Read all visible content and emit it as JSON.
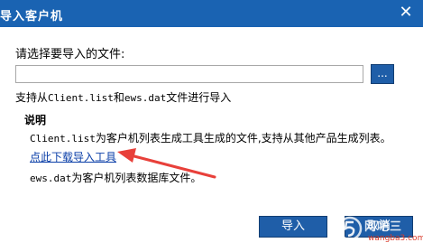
{
  "window": {
    "title": "导入客户机",
    "close_glyph": "✕"
  },
  "form": {
    "choose_label": "请选择要导入的文件:",
    "file_value": "",
    "browse_label": "...",
    "support_prefix": "支持从",
    "support_file1": "Client.list",
    "support_and": "和",
    "support_file2": "ews.dat",
    "support_suffix": "文件进行导入"
  },
  "notes": {
    "heading": "说明",
    "line1_file": "Client.list",
    "line1_text": "为客户机列表生成工具生成的文件,支持从其他产品生成列表。",
    "download_link": "点此下载导入工具",
    "line2_file": "ews.dat",
    "line2_text": "为客户机列表数据库文件。"
  },
  "buttons": {
    "import_label": "导入",
    "cancel_label": "取消"
  },
  "watermark": {
    "text": "网吧三",
    "sub": "wangba3.com"
  },
  "colors": {
    "title_bar": "#1a63b2",
    "button": "#1f5ea8",
    "link": "#0b3fa8",
    "arrow": "#e8403a"
  }
}
